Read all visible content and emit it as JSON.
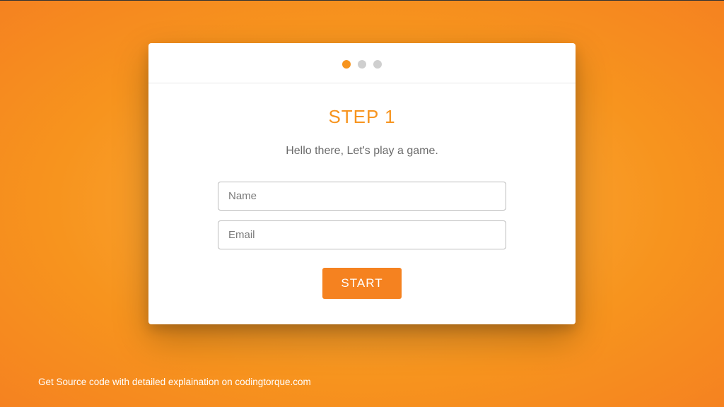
{
  "stepper": {
    "dots": 3,
    "activeIndex": 0
  },
  "step": {
    "title": "STEP 1",
    "subtitle": "Hello there, Let's play a game."
  },
  "form": {
    "name": {
      "placeholder": "Name",
      "value": ""
    },
    "email": {
      "placeholder": "Email",
      "value": ""
    },
    "button": "START"
  },
  "footer": {
    "text": "Get Source code with detailed explaination on codingtorque.com"
  },
  "colors": {
    "accent": "#f7941e",
    "buttonBg": "#f58220"
  }
}
